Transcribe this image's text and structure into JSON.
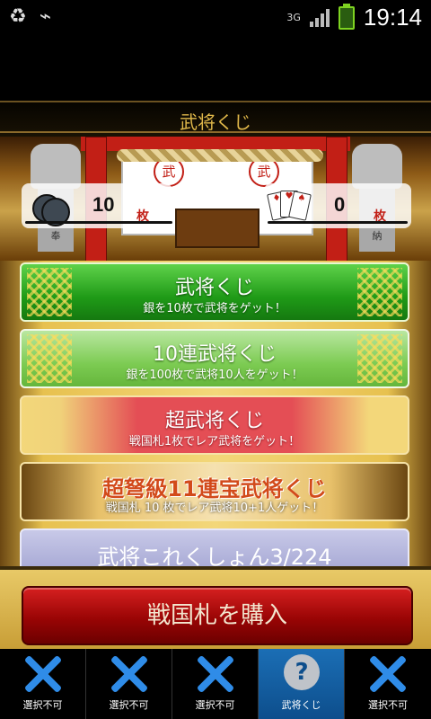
{
  "statusbar": {
    "network": "3G",
    "time": "19:14",
    "icons": [
      "recycle-icon",
      "usb-icon"
    ]
  },
  "header": {
    "title": "武将くじ"
  },
  "currency": {
    "silver": {
      "count": "10",
      "unit": "枚"
    },
    "sengoku": {
      "count": "0",
      "unit": "枚"
    }
  },
  "shrine": {
    "emblem_left": "武",
    "emblem_right": "武",
    "statue_left_char": "奉",
    "statue_right_char": "納"
  },
  "kuji_buttons": [
    {
      "title": "武将くじ",
      "subtitle": "銀を10枚で武将をゲット！"
    },
    {
      "title": "10連武将くじ",
      "subtitle": "銀を100枚で武将10人をゲット！"
    },
    {
      "title": "超武将くじ",
      "subtitle": "戦国札1枚でレア武将をゲット！"
    },
    {
      "title": "超弩級11連宝武将くじ",
      "subtitle": "戦国札 10 枚でレア武将10+1人ゲット！"
    },
    {
      "title": "武将これくしょん3/224"
    }
  ],
  "buy_button": {
    "label": "戦国札を購入"
  },
  "tabs": [
    {
      "label": "選択不可",
      "icon": "x-icon"
    },
    {
      "label": "選択不可",
      "icon": "x-icon"
    },
    {
      "label": "選択不可",
      "icon": "x-icon"
    },
    {
      "label": "武将くじ",
      "icon": "question-icon"
    },
    {
      "label": "選択不可",
      "icon": "x-icon"
    }
  ]
}
